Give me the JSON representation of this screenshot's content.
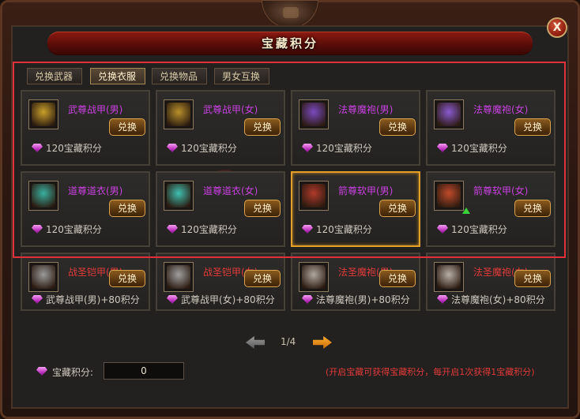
{
  "window": {
    "title": "宝藏积分",
    "close_label": "X"
  },
  "tabs": [
    {
      "label": "兑换武器",
      "active": false
    },
    {
      "label": "兑换衣服",
      "active": true
    },
    {
      "label": "兑换物品",
      "active": false
    },
    {
      "label": "男女互换",
      "active": false
    }
  ],
  "exchange_label": "兑换",
  "items": [
    {
      "name": "武尊战甲(男)",
      "cost": "120宝藏积分",
      "color": "purple",
      "icon": "gold-armor-icon",
      "icon_color": "#c9a02a"
    },
    {
      "name": "武尊战甲(女)",
      "cost": "120宝藏积分",
      "color": "purple",
      "icon": "gold-armor-icon",
      "icon_color": "#b8902a"
    },
    {
      "name": "法尊魔袍(男)",
      "cost": "120宝藏积分",
      "color": "purple",
      "icon": "mage-robe-icon",
      "icon_color": "#7a4ac0"
    },
    {
      "name": "法尊魔袍(女)",
      "cost": "120宝藏积分",
      "color": "purple",
      "icon": "mage-robe-icon",
      "icon_color": "#8a5ad0"
    },
    {
      "name": "道尊道衣(男)",
      "cost": "120宝藏积分",
      "color": "purple",
      "icon": "taoist-robe-icon",
      "icon_color": "#3ab0a0"
    },
    {
      "name": "道尊道衣(女)",
      "cost": "120宝藏积分",
      "color": "purple",
      "icon": "taoist-robe-icon",
      "icon_color": "#40c0b0"
    },
    {
      "name": "箭尊软甲(男)",
      "cost": "120宝藏积分",
      "color": "purple",
      "icon": "archer-armor-icon",
      "icon_color": "#b03a2a",
      "selected": true
    },
    {
      "name": "箭尊软甲(女)",
      "cost": "120宝藏积分",
      "color": "purple",
      "icon": "archer-armor-icon",
      "icon_color": "#c04a2a",
      "upgrade": true
    },
    {
      "name": "战圣铠甲(男)",
      "cost": "武尊战甲(男)+80积分",
      "color": "red",
      "icon": "warrior-helmet-icon",
      "icon_color": "#9a9a9a"
    },
    {
      "name": "战圣铠甲(女)",
      "cost": "武尊战甲(女)+80积分",
      "color": "red",
      "icon": "warrior-helmet-icon",
      "icon_color": "#a0a0a0"
    },
    {
      "name": "法圣魔袍(男)",
      "cost": "法尊魔袍(男)+80积分",
      "color": "red",
      "icon": "mage-helmet-icon",
      "icon_color": "#b0a8a0"
    },
    {
      "name": "法圣魔袍(女)",
      "cost": "法尊魔袍(女)+80积分",
      "color": "red",
      "icon": "mage-helmet-icon",
      "icon_color": "#b8b0a8"
    }
  ],
  "pager": {
    "page": "1/4"
  },
  "score": {
    "label": "宝藏积分:",
    "value": "0"
  },
  "hint": "(开启宝藏可获得宝藏积分，每开启1次获得1宝藏积分)"
}
